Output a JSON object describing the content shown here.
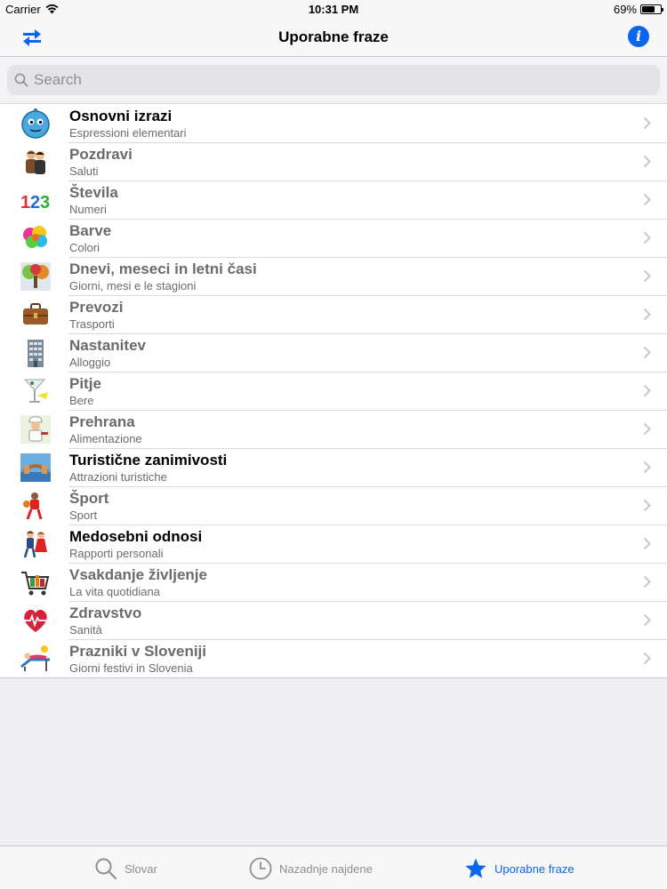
{
  "status_bar": {
    "carrier": "Carrier",
    "time": "10:31 PM",
    "battery": "69%",
    "battery_level": 0.69
  },
  "nav": {
    "title": "Uporabne fraze",
    "left_icon": "swap-arrows-icon",
    "right_icon": "info-icon"
  },
  "search": {
    "placeholder": "Search",
    "value": ""
  },
  "list": [
    {
      "title": "Osnovni izrazi",
      "subtitle": "Espressioni elementari",
      "icon": "smiley-face-icon",
      "emphasis": true
    },
    {
      "title": "Pozdravi",
      "subtitle": "Saluti",
      "icon": "greeting-couple-icon",
      "emphasis": false
    },
    {
      "title": "Števila",
      "subtitle": "Numeri",
      "icon": "numbers-123-icon",
      "emphasis": false
    },
    {
      "title": "Barve",
      "subtitle": "Colori",
      "icon": "color-splash-icon",
      "emphasis": false
    },
    {
      "title": "Dnevi, meseci in letni časi",
      "subtitle": "Giorni, mesi e le stagioni",
      "icon": "seasons-tree-icon",
      "emphasis": false
    },
    {
      "title": "Prevozi",
      "subtitle": "Trasporti",
      "icon": "suitcase-icon",
      "emphasis": false
    },
    {
      "title": "Nastanitev",
      "subtitle": "Alloggio",
      "icon": "building-icon",
      "emphasis": false
    },
    {
      "title": "Pitje",
      "subtitle": "Bere",
      "icon": "cocktail-icon",
      "emphasis": false
    },
    {
      "title": "Prehrana",
      "subtitle": "Alimentazione",
      "icon": "chef-icon",
      "emphasis": false
    },
    {
      "title": "Turistične zanimivosti",
      "subtitle": "Attrazioni turistiche",
      "icon": "landmark-icon",
      "emphasis": true
    },
    {
      "title": "Šport",
      "subtitle": "Sport",
      "icon": "basketball-player-icon",
      "emphasis": false
    },
    {
      "title": "Medosebni odnosi",
      "subtitle": "Rapporti personali",
      "icon": "dancing-couple-icon",
      "emphasis": true
    },
    {
      "title": "Vsakdanje življenje",
      "subtitle": "La vita quotidiana",
      "icon": "shopping-cart-icon",
      "emphasis": false
    },
    {
      "title": "Zdravstvo",
      "subtitle": "Sanità",
      "icon": "heartbeat-icon",
      "emphasis": false
    },
    {
      "title": "Prazniki v Sloveniji",
      "subtitle": "Giorni festivi in Slovenia",
      "icon": "beach-lounger-icon",
      "emphasis": false
    }
  ],
  "tabs": [
    {
      "label": "Slovar",
      "icon": "search-icon",
      "active": false
    },
    {
      "label": "Nazadnje najdene",
      "icon": "clock-icon",
      "active": false
    },
    {
      "label": "Uporabne fraze",
      "icon": "star-icon",
      "active": true
    }
  ],
  "colors": {
    "accent": "#0a66f0",
    "background": "#efeff4",
    "bar": "#f7f7f7",
    "subtitle": "#6b6b6b"
  }
}
